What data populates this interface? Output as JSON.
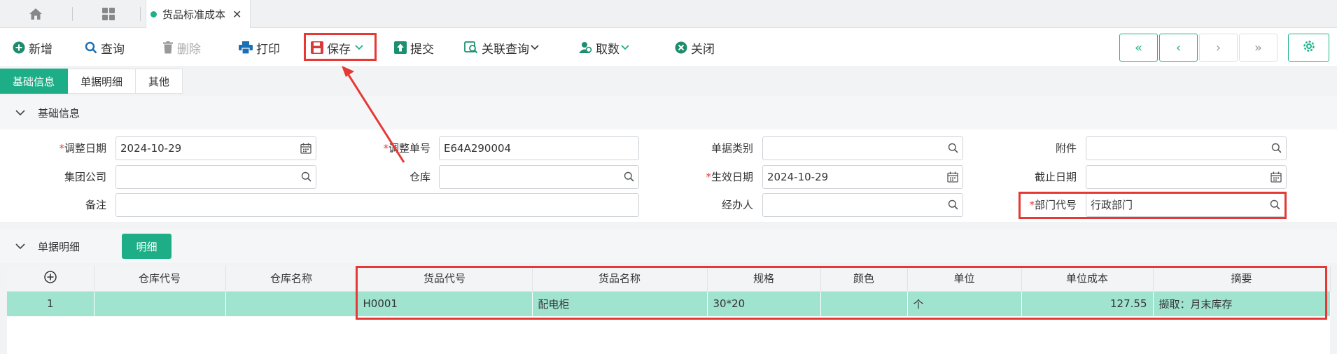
{
  "tabbar": {
    "home_icon": "home-icon",
    "grid_icon": "grid-icon",
    "doc_tab_label": "货品标准成本",
    "close_glyph": "✕"
  },
  "toolbar": {
    "add_label": "新增",
    "query_label": "查询",
    "delete_label": "删除",
    "print_label": "打印",
    "save_label": "保存",
    "submit_label": "提交",
    "related_label": "关联查询",
    "fetch_label": "取数",
    "close_label": "关闭"
  },
  "subtabs": [
    "基础信息",
    "单据明细",
    "其他"
  ],
  "sections": {
    "basic": "基础信息",
    "detail": "单据明细",
    "detail_button": "明细"
  },
  "form": {
    "adjust_date_label": "调整日期",
    "adjust_date_value": "2024-10-29",
    "adjust_no_label": "调整单号",
    "adjust_no_value": "E64A290004",
    "doc_type_label": "单据类别",
    "attachment_label": "附件",
    "group_label": "集团公司",
    "warehouse_label": "仓库",
    "effective_date_label": "生效日期",
    "effective_date_value": "2024-10-29",
    "end_date_label": "截止日期",
    "remark_label": "备注",
    "handler_label": "经办人",
    "dept_label": "部门代号",
    "dept_value": "行政部门"
  },
  "table": {
    "headers": [
      "仓库代号",
      "仓库名称",
      "货品代号",
      "货品名称",
      "规格",
      "颜色",
      "单位",
      "单位成本",
      "摘要"
    ],
    "rows": [
      {
        "no": "1",
        "wh_code": "",
        "wh_name": "",
        "item_code": "H0001",
        "item_name": "配电柜",
        "spec": "30*20",
        "color": "",
        "unit": "个",
        "unit_cost": "127.55",
        "summary": "撷取：月末库存"
      }
    ]
  },
  "colors": {
    "accent": "#1eae87",
    "highlight_row": "#a0e4d0",
    "annotation": "#e53935"
  }
}
